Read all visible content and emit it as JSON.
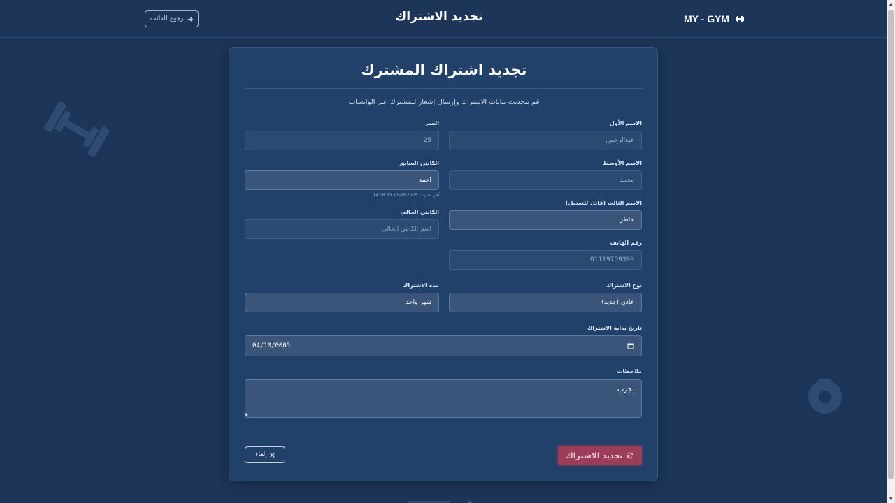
{
  "header": {
    "brand": "MY - GYM",
    "title": "تجديد الاشتراك",
    "back_label": "رجوع للقائمة"
  },
  "card": {
    "title": "تجديد اشتراك المشترك",
    "subtitle": "قم بتحديث بيانات الاشتراك وإرسال إشعار للمشترك عبر الواتساب"
  },
  "form": {
    "first_name": {
      "label": "الاسم الأول",
      "value": "عبدالرحمن"
    },
    "age": {
      "label": "العمر",
      "value": "25"
    },
    "middle_name": {
      "label": "الاسم الأوسط",
      "value": "محمد"
    },
    "previous_captain": {
      "label": "الكابتن السابق",
      "value": "احمد",
      "hint": "آخر تحديث: 2025-06-13 14:06:33"
    },
    "third_name": {
      "label": "الاسم الثالث (قابل للتعديل)",
      "value": "خاطر"
    },
    "current_captain": {
      "label": "الكابتن الحالي",
      "placeholder": "اسم الكابتن الحالي"
    },
    "phone": {
      "label": "رقم الهاتف",
      "value": "01119709399"
    },
    "subscription_type": {
      "label": "نوع الاشتراك",
      "value": "عادي (جديد)"
    },
    "duration": {
      "label": "مدة الاشتراك",
      "value": "شهر واحد"
    },
    "start_date": {
      "label": "تاريخ بداية الاشتراك",
      "value": "04/10/0005"
    },
    "notes": {
      "label": "ملاحظات",
      "value": "بجرب"
    }
  },
  "actions": {
    "submit_label": "تجديد الاشتراك",
    "cancel_label": "إلغاء"
  },
  "colors": {
    "background": "#1c3558",
    "card": "#21406a",
    "accent": "#9b3c58"
  }
}
